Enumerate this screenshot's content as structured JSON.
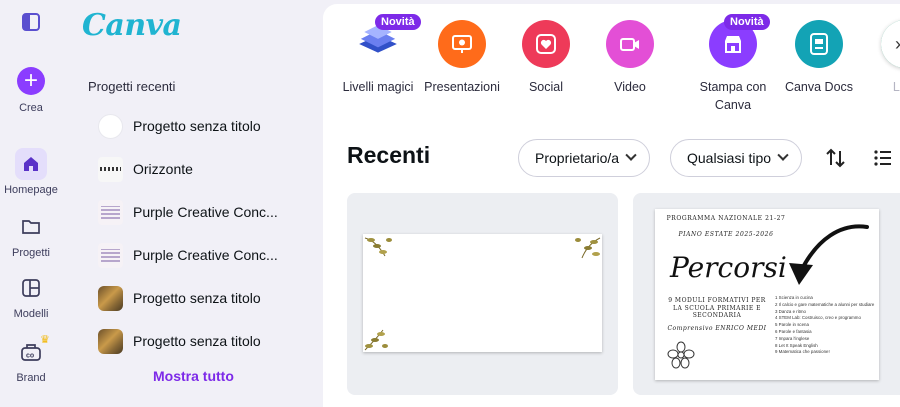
{
  "rail": {
    "create_label": "Crea",
    "items": [
      {
        "label": "Homepage",
        "icon": "home-icon",
        "active": true
      },
      {
        "label": "Progetti",
        "icon": "folder-icon",
        "active": false
      },
      {
        "label": "Modelli",
        "icon": "templates-icon",
        "active": false
      },
      {
        "label": "Brand",
        "icon": "brand-icon",
        "active": false
      }
    ]
  },
  "panel": {
    "logo": "Canva",
    "section_title": "Progetti recenti",
    "recent": [
      {
        "label": "Progetto senza titolo",
        "thumb": "white"
      },
      {
        "label": "Orizzonte",
        "thumb": "sketch"
      },
      {
        "label": "Purple Creative Conc...",
        "thumb": "purple"
      },
      {
        "label": "Purple Creative Conc...",
        "thumb": "purple"
      },
      {
        "label": "Progetto senza titolo",
        "thumb": "photo"
      },
      {
        "label": "Progetto senza titolo",
        "thumb": "photo"
      }
    ],
    "show_all": "Mostra tutto"
  },
  "shortcuts": [
    {
      "label": "Livelli magici",
      "badge": "Novità",
      "color": "#3d5bd9",
      "icon": "magic-layers-icon"
    },
    {
      "label": "Presentazioni",
      "badge": "",
      "color": "#ff6b1a",
      "icon": "presentation-icon"
    },
    {
      "label": "Social",
      "badge": "",
      "color": "#ee3a59",
      "icon": "heart-icon"
    },
    {
      "label": "Video",
      "badge": "",
      "color": "#e34fd6",
      "icon": "video-camera-icon"
    },
    {
      "label": "Stampa con Canva",
      "badge": "Novità",
      "color": "#8b3dff",
      "icon": "store-icon"
    },
    {
      "label": "Canva Docs",
      "badge": "",
      "color": "#13a3b5",
      "icon": "docs-icon"
    },
    {
      "label": "La...",
      "badge": "",
      "color": "#1fb889",
      "icon": "chevron-right-icon"
    }
  ],
  "recent_section": {
    "title": "Recenti",
    "filter_owner": "Proprietario/a",
    "filter_type": "Qualsiasi tipo"
  },
  "doc2": {
    "title": "PROGRAMMA NAZIONALE 21-27",
    "subtitle_italic": "PIANO ESTATE 2025-2026",
    "big": "Percorsi",
    "sub": "9 MODULI FORMATIVI PER LA SCUOLA PRIMARIE E SECONDARIA",
    "school": "Comprensivo ENRICO MEDI",
    "list": [
      "1 Scienza in cucina",
      "2 Il calcio e gare matematiche a alunni per studiare",
      "3 Danza e ritmo",
      "4 STEM Lab: Costruisco, creo e programmo",
      "5 Parole in scena",
      "6 Parole e fantasia",
      "7 Impara l'inglese",
      "8 Let It Speak English",
      "9 Matematica che passione!"
    ]
  }
}
